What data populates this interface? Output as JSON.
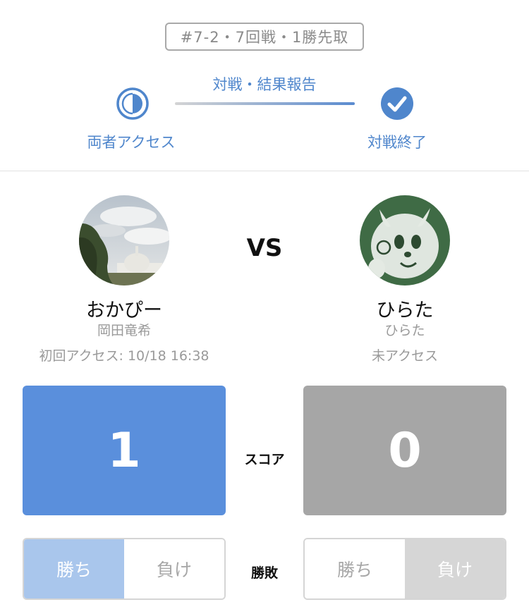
{
  "match": {
    "badge": "#7-2・7回戦・1勝先取"
  },
  "status": {
    "center_label": "対戦・結果報告",
    "left_label": "両者アクセス",
    "right_label": "対戦終了",
    "accent": "#4f86cc"
  },
  "vs_label": "VS",
  "player1": {
    "display_name": "おかぴー",
    "real_name": "岡田竜希",
    "access": "初回アクセス: 10/18 16:38",
    "score": "1",
    "score_color": "#5a8fdc"
  },
  "player2": {
    "display_name": "ひらた",
    "real_name": "ひらた",
    "access": "未アクセス",
    "score": "0",
    "score_color": "#a6a6a6"
  },
  "labels": {
    "score": "スコア",
    "result": "勝敗",
    "win": "勝ち",
    "lose": "負け"
  },
  "result_selection": {
    "player1": "win",
    "player2": "lose"
  }
}
